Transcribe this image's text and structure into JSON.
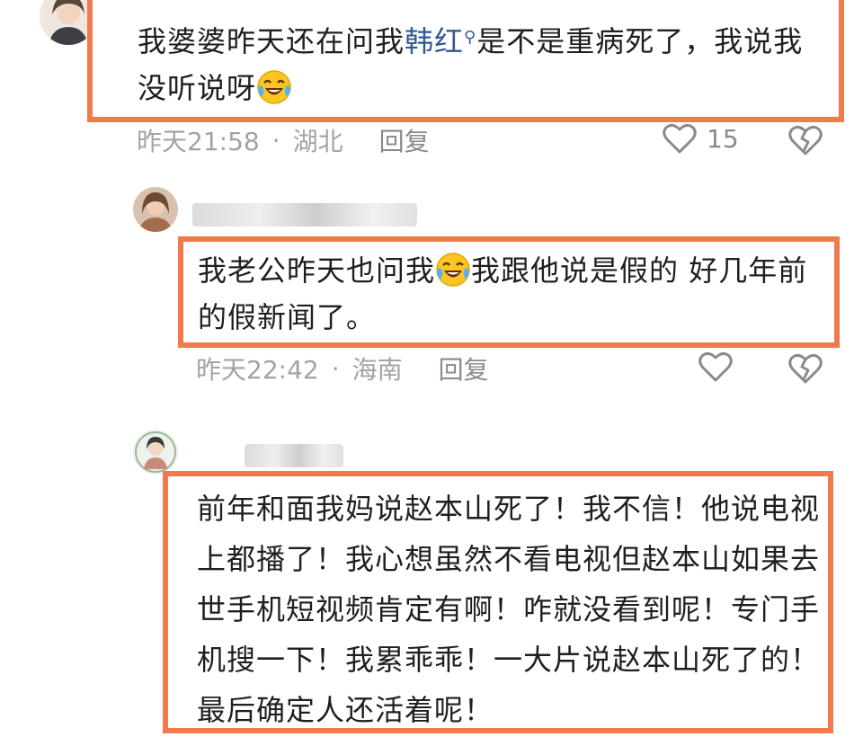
{
  "comments": [
    {
      "text_before": "我婆婆昨天还在问我",
      "topic": "韩红",
      "text_after": "是不是重病死了，我说我没听说呀",
      "time": "昨天21:58",
      "location": "湖北",
      "reply_label": "回复",
      "like_count": "15"
    },
    {
      "text_before": "我老公昨天也问我",
      "text_after": "我跟他说是假的 好几年前的假新闻了。",
      "time": "昨天22:42",
      "location": "海南",
      "reply_label": "回复"
    },
    {
      "text": "前年和面我妈说赵本山死了！我不信！他说电视上都播了！我心想虽然不看电视但赵本山如果去世手机短视频肯定有啊！咋就没看到呢！专门手机搜一下！我累乖乖！一大片说赵本山死了的！最后确定人还活着呢！"
    }
  ],
  "separator": "·",
  "colors": {
    "highlight_border": "#f07a4c",
    "topic_link": "#2f5a92",
    "meta_text": "#a3a3a3"
  },
  "icons": {
    "search": "search-icon",
    "like": "heart-outline-icon",
    "dislike": "broken-heart-icon",
    "emoji": "laughing-crying-emoji"
  }
}
